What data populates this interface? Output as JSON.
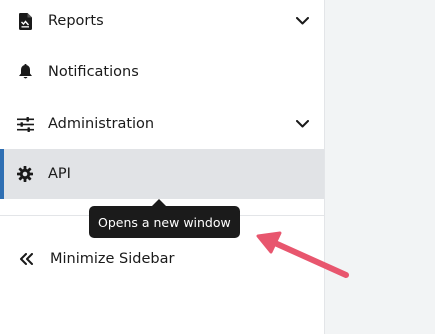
{
  "sidebar": {
    "items": [
      {
        "id": "reports",
        "label": "Reports",
        "icon": "report-document-icon",
        "expandable": true
      },
      {
        "id": "notifications",
        "label": "Notifications",
        "icon": "bell-icon",
        "expandable": false
      },
      {
        "id": "administration",
        "label": "Administration",
        "icon": "sliders-icon",
        "expandable": true
      },
      {
        "id": "api",
        "label": "API",
        "icon": "gear-icon",
        "expandable": false,
        "active": true
      }
    ],
    "minimize": {
      "label": "Minimize Sidebar",
      "icon": "double-chevron-left-icon"
    }
  },
  "tooltip": {
    "text": "Opens a new window"
  },
  "colors": {
    "active_bar": "#2f6fb3",
    "active_bg": "#e1e3e6",
    "tooltip_bg": "#1b1b1b",
    "annotation_arrow": "#e8566e",
    "main_bg": "#f2f4f5"
  }
}
